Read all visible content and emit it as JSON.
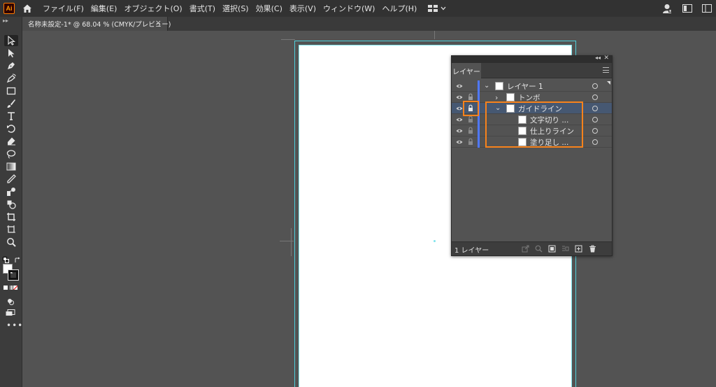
{
  "app": {
    "logo": "Ai"
  },
  "menu": [
    "ファイル(F)",
    "編集(E)",
    "オブジェクト(O)",
    "書式(T)",
    "選択(S)",
    "効果(C)",
    "表示(V)",
    "ウィンドウ(W)",
    "ヘルプ(H)"
  ],
  "document_tab": {
    "title": "名称未設定-1* @ 68.04 % (CMYK/プレビュー)",
    "close": "×"
  },
  "layers_panel": {
    "tab_label": "レイヤー",
    "footer_count": "1 レイヤー",
    "rows": [
      {
        "name": "レイヤー 1",
        "expanded": true,
        "locked": false,
        "selected": false
      },
      {
        "name": "トンボ",
        "expanded": false,
        "locked": true,
        "selected": false
      },
      {
        "name": "ガイドライン",
        "expanded": true,
        "locked": true,
        "selected": true
      },
      {
        "name": "文字切り ...",
        "locked": true,
        "selected": false
      },
      {
        "name": "仕上りライン",
        "locked": true,
        "selected": false
      },
      {
        "name": "塗り足し ...",
        "locked": true,
        "selected": false
      }
    ]
  },
  "colors": {
    "accent_highlight": "#f7821b",
    "layer_color": "#4f78ff",
    "selected_row": "#465872",
    "guide": "#7fe4ec"
  },
  "icons": {
    "toolbar": [
      "selection-tool-icon",
      "direct-selection-tool-icon",
      "pen-tool-icon",
      "curvature-tool-icon",
      "rectangle-tool-icon",
      "paintbrush-tool-icon",
      "type-tool-icon",
      "rotate-tool-icon",
      "eraser-tool-icon",
      "lasso-tool-icon",
      "gradient-tool-icon",
      "eyedropper-tool-icon",
      "blend-tool-icon",
      "shape-builder-tool-icon",
      "crop-tool-icon",
      "artboard-tool-icon",
      "zoom-tool-icon"
    ]
  }
}
